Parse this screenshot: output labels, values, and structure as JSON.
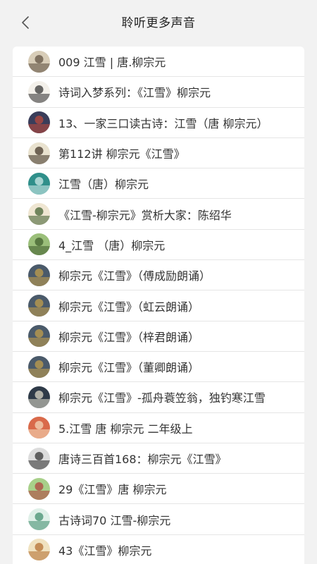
{
  "header": {
    "title": "聆听更多声音"
  },
  "items": [
    {
      "label": "009 江雪 | 唐.柳宗元",
      "avatar": {
        "bg": "#d8cdb8",
        "fg": "#5a4a3a"
      }
    },
    {
      "label": "诗词入梦系列：《江雪》柳宗元",
      "avatar": {
        "bg": "#f3f0ea",
        "fg": "#2a2a2a"
      }
    },
    {
      "label": "13、一家三口读古诗：江雪（唐 柳宗元）",
      "avatar": {
        "bg": "#3a3d5a",
        "fg": "#c24a3a"
      }
    },
    {
      "label": "第112讲 柳宗元《江雪》",
      "avatar": {
        "bg": "#e9e2cf",
        "fg": "#3a2e20"
      }
    },
    {
      "label": "江雪（唐）柳宗元",
      "avatar": {
        "bg": "#2f8f8a",
        "fg": "#d9f0ee"
      }
    },
    {
      "label": "《江雪-柳宗元》赏析大家：陈绍华",
      "avatar": {
        "bg": "#efe6d2",
        "fg": "#3a5a2a"
      }
    },
    {
      "label": "4_江雪 （唐）柳宗元",
      "avatar": {
        "bg": "#9bbf7a",
        "fg": "#3c5a2a"
      }
    },
    {
      "label": "柳宗元《江雪》（傅成励朗诵）",
      "avatar": {
        "bg": "#4a5a6a",
        "fg": "#c9a24a"
      }
    },
    {
      "label": "柳宗元《江雪》（虹云朗诵）",
      "avatar": {
        "bg": "#4a5a6a",
        "fg": "#c9a24a"
      }
    },
    {
      "label": "柳宗元《江雪》（梓君朗诵）",
      "avatar": {
        "bg": "#4a5a6a",
        "fg": "#c9a24a"
      }
    },
    {
      "label": "柳宗元《江雪》（董卿朗诵）",
      "avatar": {
        "bg": "#4a5a6a",
        "fg": "#c9a24a"
      }
    },
    {
      "label": "柳宗元《江雪》-孤舟蓑笠翁，独钓寒江雪",
      "avatar": {
        "bg": "#2e3a48",
        "fg": "#e8e2d0"
      }
    },
    {
      "label": "5.江雪 唐 柳宗元 二年级上",
      "avatar": {
        "bg": "#d96a4a",
        "fg": "#f5e0c0"
      }
    },
    {
      "label": "唐诗三百首168：柳宗元《江雪》",
      "avatar": {
        "bg": "#dcdcdc",
        "fg": "#2a2a2a"
      }
    },
    {
      "label": "29《江雪》唐 柳宗元",
      "avatar": {
        "bg": "#a8d08a",
        "fg": "#b03a3a"
      }
    },
    {
      "label": "古诗词70 江雪-柳宗元",
      "avatar": {
        "bg": "#dff0e8",
        "fg": "#3a8a6a"
      }
    },
    {
      "label": "43《江雪》柳宗元",
      "avatar": {
        "bg": "#f0e2c0",
        "fg": "#b06a2a"
      }
    }
  ]
}
